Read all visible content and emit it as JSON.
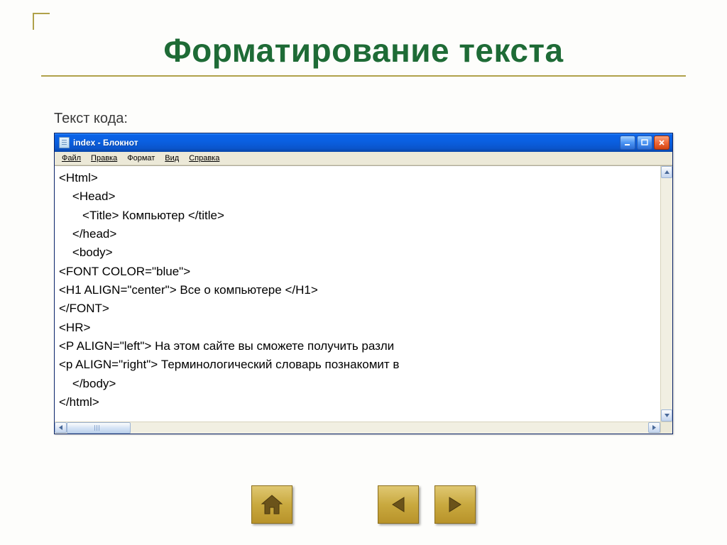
{
  "slide": {
    "title": "Форматирование текста",
    "subtitle": "Текст кода:"
  },
  "notepad": {
    "window_title": "index - Блокнот",
    "menu": {
      "file": "Файл",
      "edit": "Правка",
      "format": "Формат",
      "view": "Вид",
      "help": "Справка"
    },
    "code_lines": [
      "<Html>",
      "    <Head>",
      "       <Title> Компьютер </title>",
      "    </head>",
      "    <body>",
      "<FONT COLOR=\"blue\">",
      "<H1 ALIGN=\"center\"> Все о компьютере </H1>",
      "</FONT>",
      "<HR>",
      "<P ALIGN=\"left\"> На этом сайте вы сможете получить разли",
      "<p ALIGN=\"right\"> Терминологический словарь познакомит в",
      "    </body>",
      "</html>"
    ]
  },
  "nav": {
    "home": "home",
    "prev": "prev",
    "next": "next"
  }
}
